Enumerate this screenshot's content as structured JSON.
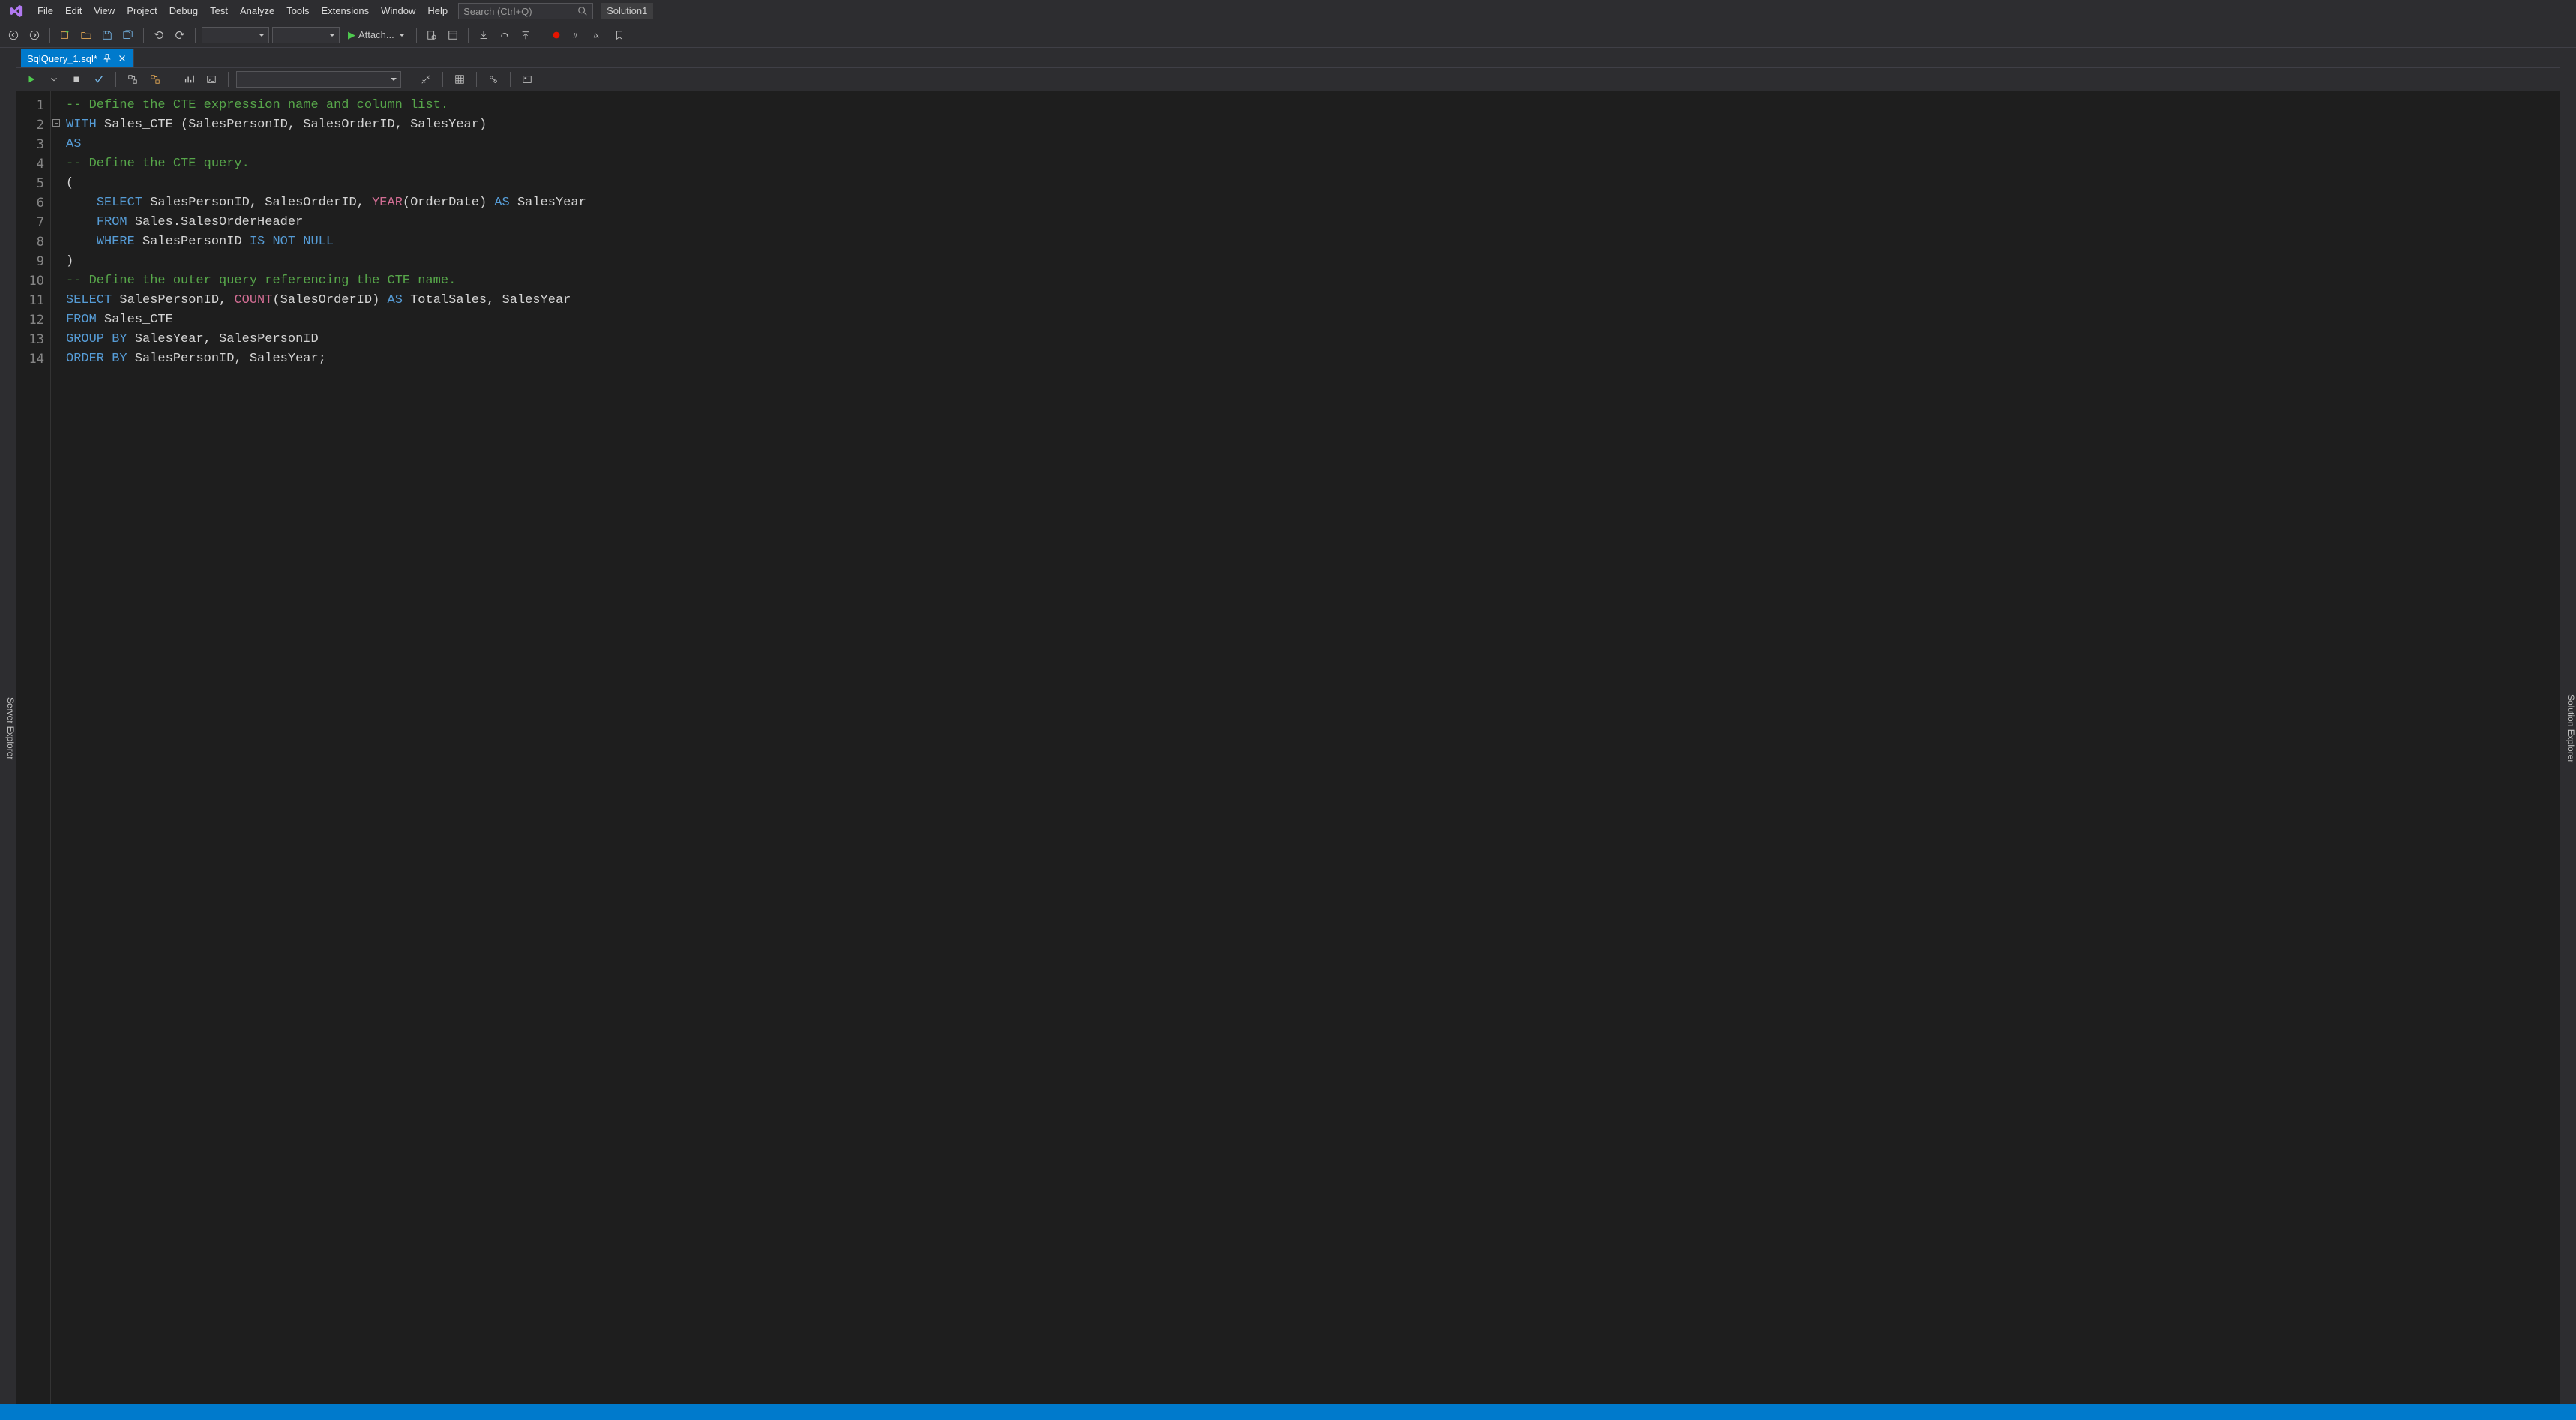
{
  "menubar": {
    "items": [
      "File",
      "Edit",
      "View",
      "Project",
      "Debug",
      "Test",
      "Analyze",
      "Tools",
      "Extensions",
      "Window",
      "Help"
    ],
    "search_placeholder": "Search (Ctrl+Q)",
    "solution_label": "Solution1"
  },
  "toolbar": {
    "attach_label": "Attach..."
  },
  "side_tool": {
    "left_label": "Server Explorer",
    "right_label": "Solution Explorer"
  },
  "document": {
    "tab_name": "SqlQuery_1.sql*",
    "pinned": false
  },
  "editor": {
    "line_count": 14,
    "lines": [
      {
        "tokens": [
          {
            "t": "-- Define the CTE expression name and column list.",
            "c": "cmt"
          }
        ]
      },
      {
        "tokens": [
          {
            "t": "WITH",
            "c": "kw"
          },
          {
            "t": " "
          },
          {
            "t": "Sales_CTE",
            "c": "pn"
          },
          {
            "t": " ("
          },
          {
            "t": "SalesPersonID",
            "c": "pn"
          },
          {
            "t": ", "
          },
          {
            "t": "SalesOrderID",
            "c": "pn"
          },
          {
            "t": ", "
          },
          {
            "t": "SalesYear",
            "c": "pn"
          },
          {
            "t": ")"
          }
        ]
      },
      {
        "tokens": [
          {
            "t": "AS",
            "c": "kw"
          }
        ]
      },
      {
        "tokens": [
          {
            "t": "-- Define the CTE query.",
            "c": "cmt"
          }
        ]
      },
      {
        "tokens": [
          {
            "t": "("
          }
        ]
      },
      {
        "tokens": [
          {
            "t": "    "
          },
          {
            "t": "SELECT",
            "c": "kw"
          },
          {
            "t": " "
          },
          {
            "t": "SalesPersonID",
            "c": "pn"
          },
          {
            "t": ", "
          },
          {
            "t": "SalesOrderID",
            "c": "pn"
          },
          {
            "t": ", "
          },
          {
            "t": "YEAR",
            "c": "fn"
          },
          {
            "t": "("
          },
          {
            "t": "OrderDate",
            "c": "pn"
          },
          {
            "t": ") "
          },
          {
            "t": "AS",
            "c": "kw"
          },
          {
            "t": " "
          },
          {
            "t": "SalesYear",
            "c": "pn"
          }
        ]
      },
      {
        "tokens": [
          {
            "t": "    "
          },
          {
            "t": "FROM",
            "c": "kw"
          },
          {
            "t": " "
          },
          {
            "t": "Sales.SalesOrderHeader",
            "c": "pn"
          }
        ]
      },
      {
        "tokens": [
          {
            "t": "    "
          },
          {
            "t": "WHERE",
            "c": "kw"
          },
          {
            "t": " "
          },
          {
            "t": "SalesPersonID",
            "c": "pn"
          },
          {
            "t": " "
          },
          {
            "t": "IS NOT NULL",
            "c": "kw"
          }
        ]
      },
      {
        "tokens": [
          {
            "t": ")"
          }
        ]
      },
      {
        "tokens": [
          {
            "t": "-- Define the outer query referencing the CTE name.",
            "c": "cmt"
          }
        ]
      },
      {
        "tokens": [
          {
            "t": "SELECT",
            "c": "kw"
          },
          {
            "t": " "
          },
          {
            "t": "SalesPersonID",
            "c": "pn"
          },
          {
            "t": ", "
          },
          {
            "t": "COUNT",
            "c": "fn"
          },
          {
            "t": "("
          },
          {
            "t": "SalesOrderID",
            "c": "pn"
          },
          {
            "t": ") "
          },
          {
            "t": "AS",
            "c": "kw"
          },
          {
            "t": " "
          },
          {
            "t": "TotalSales",
            "c": "pn"
          },
          {
            "t": ", "
          },
          {
            "t": "SalesYear",
            "c": "pn"
          }
        ]
      },
      {
        "tokens": [
          {
            "t": "FROM",
            "c": "kw"
          },
          {
            "t": " "
          },
          {
            "t": "Sales_CTE",
            "c": "pn"
          }
        ]
      },
      {
        "tokens": [
          {
            "t": "GROUP BY",
            "c": "kw"
          },
          {
            "t": " "
          },
          {
            "t": "SalesYear",
            "c": "pn"
          },
          {
            "t": ", "
          },
          {
            "t": "SalesPersonID",
            "c": "pn"
          }
        ]
      },
      {
        "tokens": [
          {
            "t": "ORDER BY",
            "c": "kw"
          },
          {
            "t": " "
          },
          {
            "t": "SalesPersonID",
            "c": "pn"
          },
          {
            "t": ", "
          },
          {
            "t": "SalesYear",
            "c": "pn"
          },
          {
            "t": ";"
          }
        ]
      }
    ]
  }
}
